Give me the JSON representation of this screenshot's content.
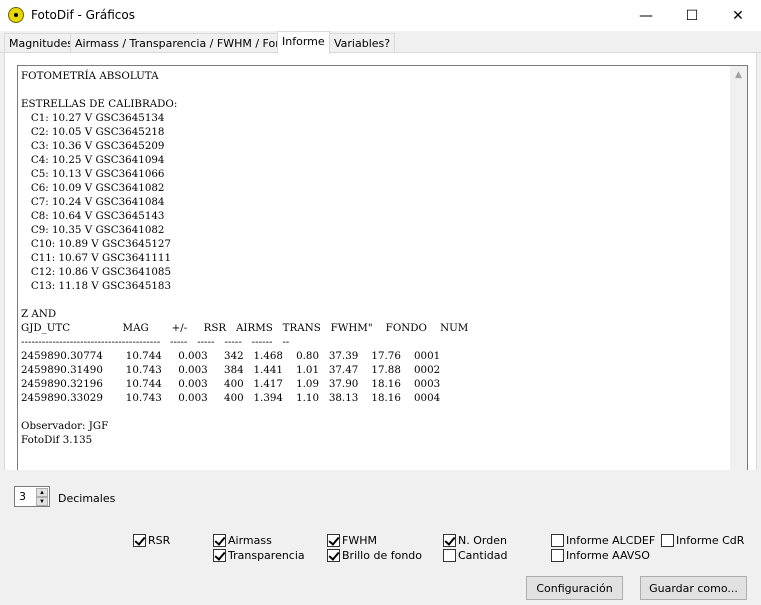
{
  "window": {
    "title": "FotoDif - Gráficos",
    "minimize_glyph": "—",
    "maximize_glyph": "☐",
    "close_glyph": "✕"
  },
  "tabs": [
    {
      "label": "Magnitudes"
    },
    {
      "label": "Airmass / Transparencia / FWHM / Fondo"
    },
    {
      "label": "Informe"
    },
    {
      "label": "Variables?"
    }
  ],
  "report": {
    "lines": [
      "FOTOMETRÍA ABSOLUTA",
      "",
      "ESTRELLAS DE CALIBRADO:",
      "   C1: 10.27 V GSC3645134",
      "   C2: 10.05 V GSC3645218",
      "   C3: 10.36 V GSC3645209",
      "   C4: 10.25 V GSC3641094",
      "   C5: 10.13 V GSC3641066",
      "   C6: 10.09 V GSC3641082",
      "   C7: 10.24 V GSC3641084",
      "   C8: 10.64 V GSC3645143",
      "   C9: 10.35 V GSC3641082",
      "   C10: 10.89 V GSC3645127",
      "   C11: 10.67 V GSC3641111",
      "   C12: 10.86 V GSC3641085",
      "   C13: 11.18 V GSC3645183",
      "",
      "Z AND",
      "GJD_UTC                MAG       +/-     RSR   AIRMS   TRANS   FWHM\"    FONDO    NUM",
      "----------------------------------------   -----   -----   -----   ------   --",
      "2459890.30774       10.744     0.003     342   1.468    0.80   37.39    17.76    0001",
      "2459890.31490       10.743     0.003     384   1.441    1.01   37.47    17.88    0002",
      "2459890.32196       10.744     0.003     400   1.417    1.09   37.90    18.16    0003",
      "2459890.33029       10.743     0.003     400   1.394    1.10   38.13    18.16    0004",
      "",
      "Observador: JGF",
      "FotoDif 3.135"
    ]
  },
  "controls": {
    "decimales_value": "3",
    "decimales_label": "Decimales",
    "checkboxes": {
      "rsr": {
        "label": "RSR",
        "checked": true
      },
      "airmass": {
        "label": "Airmass",
        "checked": true
      },
      "transparencia": {
        "label": "Transparencia",
        "checked": true
      },
      "fwhm": {
        "label": "FWHM",
        "checked": true
      },
      "brillo_fondo": {
        "label": "Brillo de fondo",
        "checked": true
      },
      "n_orden": {
        "label": "N. Orden",
        "checked": true
      },
      "cantidad": {
        "label": "Cantidad",
        "checked": false
      },
      "informe_alcdef": {
        "label": "Informe ALCDEF",
        "checked": false
      },
      "informe_aavso": {
        "label": "Informe AAVSO",
        "checked": false
      },
      "informe_cdr": {
        "label": "Informe CdR",
        "checked": false
      }
    },
    "buttons": {
      "configuracion": "Configuración",
      "guardar": "Guardar como..."
    }
  }
}
